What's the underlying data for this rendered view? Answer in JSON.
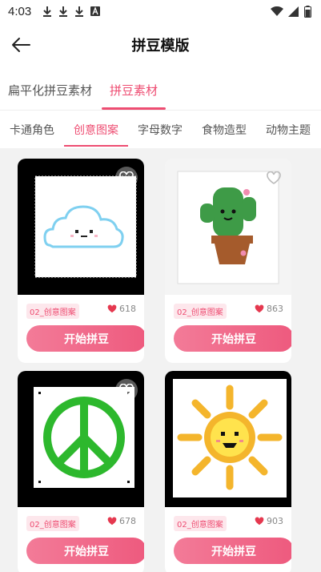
{
  "status": {
    "time": "4:03"
  },
  "header": {
    "title": "拼豆模版"
  },
  "tabs_primary": [
    {
      "label": "扁平化拼豆素材",
      "active": false
    },
    {
      "label": "拼豆素材",
      "active": true
    }
  ],
  "tabs_secondary": [
    {
      "label": "卡通角色",
      "active": false
    },
    {
      "label": "创意图案",
      "active": true
    },
    {
      "label": "字母数字",
      "active": false
    },
    {
      "label": "食物造型",
      "active": false
    },
    {
      "label": "动物主题",
      "active": false
    }
  ],
  "cards": [
    {
      "image": "cloud-pattern",
      "tag": "02_创意图案",
      "likes": "618",
      "button": "开始拼豆"
    },
    {
      "image": "cactus-pattern",
      "tag": "02_创意图案",
      "likes": "863",
      "button": "开始拼豆"
    },
    {
      "image": "peace-sign-pattern",
      "tag": "02_创意图案",
      "likes": "678",
      "button": "开始拼豆"
    },
    {
      "image": "sun-pattern",
      "tag": "02_创意图案",
      "likes": "903",
      "button": "开始拼豆"
    }
  ],
  "colors": {
    "accent": "#ee4d72",
    "button_start": "#f37b98",
    "button_end": "#ee5a7e",
    "background": "#f2f2f2"
  }
}
